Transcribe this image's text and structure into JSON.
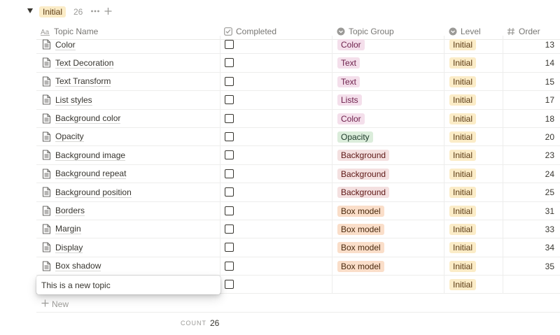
{
  "group": {
    "label": "Initial",
    "count": "26"
  },
  "columns": {
    "name": "Topic Name",
    "completed": "Completed",
    "group": "Topic Group",
    "level": "Level",
    "order": "Order"
  },
  "rows": [
    {
      "name": "Color",
      "group": "Color",
      "group_bg": "#f4dfeb",
      "group_fg": "#6c1e4a",
      "level": "Initial",
      "order": "13"
    },
    {
      "name": "Text Decoration",
      "group": "Text",
      "group_bg": "#f4dfeb",
      "group_fg": "#6c1e4a",
      "level": "Initial",
      "order": "14"
    },
    {
      "name": "Text Transform",
      "group": "Text",
      "group_bg": "#f4dfeb",
      "group_fg": "#6c1e4a",
      "level": "Initial",
      "order": "15"
    },
    {
      "name": "List styles",
      "group": "Lists",
      "group_bg": "#f4dfeb",
      "group_fg": "#6c1e4a",
      "level": "Initial",
      "order": "17"
    },
    {
      "name": "Background color",
      "group": "Color",
      "group_bg": "#f4dfeb",
      "group_fg": "#6c1e4a",
      "level": "Initial",
      "order": "18"
    },
    {
      "name": "Opacity",
      "group": "Opacity",
      "group_bg": "#dbeddb",
      "group_fg": "#1c3829",
      "level": "Initial",
      "order": "20"
    },
    {
      "name": "Background image",
      "group": "Background",
      "group_bg": "#f4e0e0",
      "group_fg": "#5d1715",
      "level": "Initial",
      "order": "23"
    },
    {
      "name": "Background repeat",
      "group": "Background",
      "group_bg": "#f4e0e0",
      "group_fg": "#5d1715",
      "level": "Initial",
      "order": "24"
    },
    {
      "name": "Background position",
      "group": "Background",
      "group_bg": "#f4e0e0",
      "group_fg": "#5d1715",
      "level": "Initial",
      "order": "25"
    },
    {
      "name": "Borders",
      "group": "Box model",
      "group_bg": "#fadec9",
      "group_fg": "#49290e",
      "level": "Initial",
      "order": "31"
    },
    {
      "name": "Margin",
      "group": "Box model",
      "group_bg": "#fadec9",
      "group_fg": "#49290e",
      "level": "Initial",
      "order": "33"
    },
    {
      "name": "Display",
      "group": "Box model",
      "group_bg": "#fadec9",
      "group_fg": "#49290e",
      "level": "Initial",
      "order": "34"
    },
    {
      "name": "Box shadow",
      "group": "Box model",
      "group_bg": "#fadec9",
      "group_fg": "#49290e",
      "level": "Initial",
      "order": "35"
    }
  ],
  "new_row": {
    "value": "This is a new topic",
    "level": "Initial"
  },
  "new_button": "New",
  "footer": {
    "count_label": "COUNT",
    "count_value": "26"
  },
  "icons": {
    "toggle": "triangle-down-icon",
    "more": "more-dots-icon",
    "add": "plus-icon",
    "name_col": "text-aa-icon",
    "completed_col": "checkbox-icon",
    "group_col": "select-icon",
    "level_col": "select-icon",
    "order_col": "hash-icon",
    "page": "document-icon"
  }
}
